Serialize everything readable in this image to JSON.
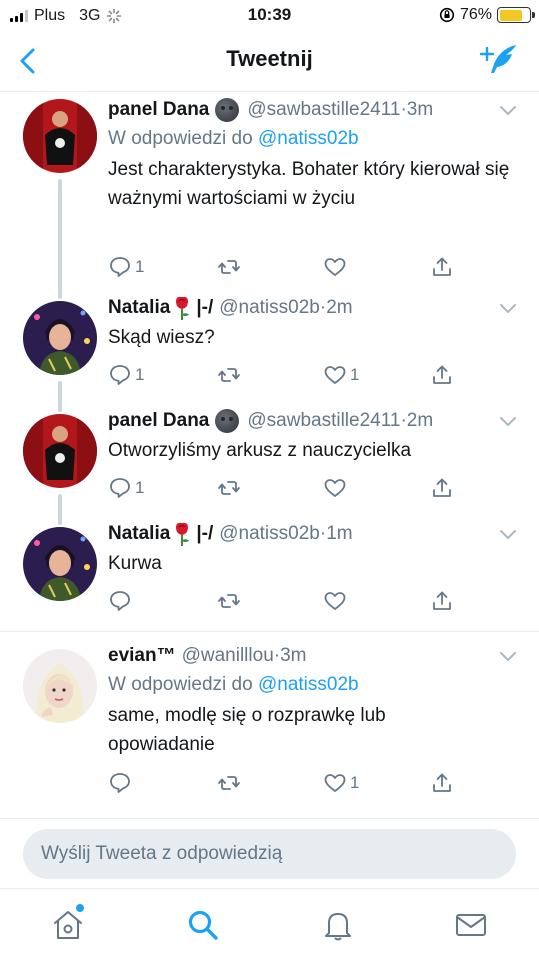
{
  "status_bar": {
    "carrier": "Plus",
    "network": "3G",
    "time": "10:39",
    "battery": "76%",
    "battery_level": 0.76
  },
  "header": {
    "title": "Tweetnij",
    "back_icon": "chevron-left-icon",
    "compose_icon": "compose-quill-icon"
  },
  "tweets": [
    {
      "name": "panel Dana",
      "handle": "@sawbastille2411",
      "dot": "·",
      "time": "3m",
      "reply_prefix": "W odpowiedzi do",
      "reply_to": "@natiss02b",
      "text": "Jest charakterystyka. Bohater który kierował się ważnymi wartościami w życiu",
      "reply_count": "1",
      "like_count": ""
    },
    {
      "name": "Natalia",
      "name_suffix": "|-/",
      "handle": "@natiss02b",
      "dot": "·",
      "time": "2m",
      "text": "Skąd wiesz?",
      "reply_count": "1",
      "like_count": "1"
    },
    {
      "name": "panel Dana",
      "handle": "@sawbastille2411",
      "dot": "·",
      "time": "2m",
      "text": "Otworzyliśmy arkusz z nauczycielka",
      "reply_count": "1",
      "like_count": ""
    },
    {
      "name": "Natalia",
      "name_suffix": "|-/",
      "handle": "@natiss02b",
      "dot": "·",
      "time": "1m",
      "text": "Kurwa",
      "reply_count": "",
      "like_count": ""
    },
    {
      "name": "evian™",
      "handle": "@wanilllou",
      "dot": "·",
      "time": "3m",
      "reply_prefix": "W odpowiedzi do",
      "reply_to": "@natiss02b",
      "text": "same, modlę się o rozprawkę lub opowiadanie",
      "reply_count": "",
      "like_count": "1"
    }
  ],
  "reply_box": {
    "placeholder": "Wyślij Tweeta z odpowiedzią"
  },
  "tab_bar": {
    "items": [
      "home-icon",
      "search-icon",
      "notifications-bell-icon",
      "messages-envelope-icon"
    ],
    "active": "search-icon"
  },
  "colors": {
    "accent": "#1da1f2",
    "text": "#14171a",
    "secondary": "#657786",
    "divider": "#e6ecf0"
  }
}
